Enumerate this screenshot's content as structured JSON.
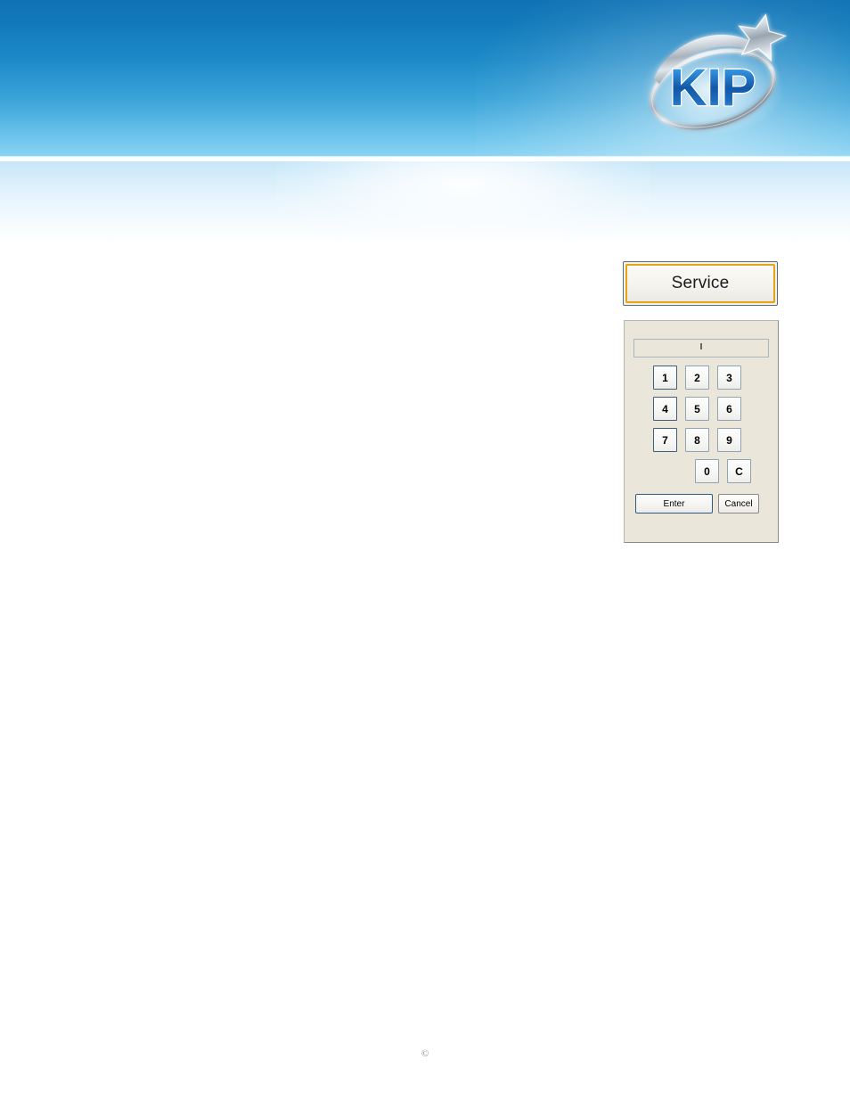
{
  "header": {
    "logo": {
      "name": "kip-logo",
      "wordmark": "KIP",
      "accent_blue": "#1b63b5",
      "accent_blue_light": "#4aa3e8",
      "silver": "#cfd6db"
    },
    "banner_top_color": "#0f72b5",
    "banner_bottom_color": "#9adbf5",
    "divider_color": "#ffffff"
  },
  "service": {
    "button_label": "Service",
    "border_color": "#e8a317",
    "face_color": "#f2f1ec"
  },
  "keypad": {
    "panel_bg": "#eae7da",
    "display": {
      "value": "",
      "placeholder": "",
      "border_color": "#a8b6c2"
    },
    "rows": [
      [
        "1",
        "2",
        "3"
      ],
      [
        "4",
        "5",
        "6"
      ],
      [
        "7",
        "8",
        "9"
      ],
      [
        "0",
        "C"
      ]
    ],
    "keys": {
      "k1": "1",
      "k2": "2",
      "k3": "3",
      "k4": "4",
      "k5": "5",
      "k6": "6",
      "k7": "7",
      "k8": "8",
      "k9": "9",
      "k0": "0",
      "kc": "C"
    },
    "enter_label": "Enter",
    "cancel_label": "Cancel"
  },
  "footer": {
    "copyright_mark": "©"
  }
}
